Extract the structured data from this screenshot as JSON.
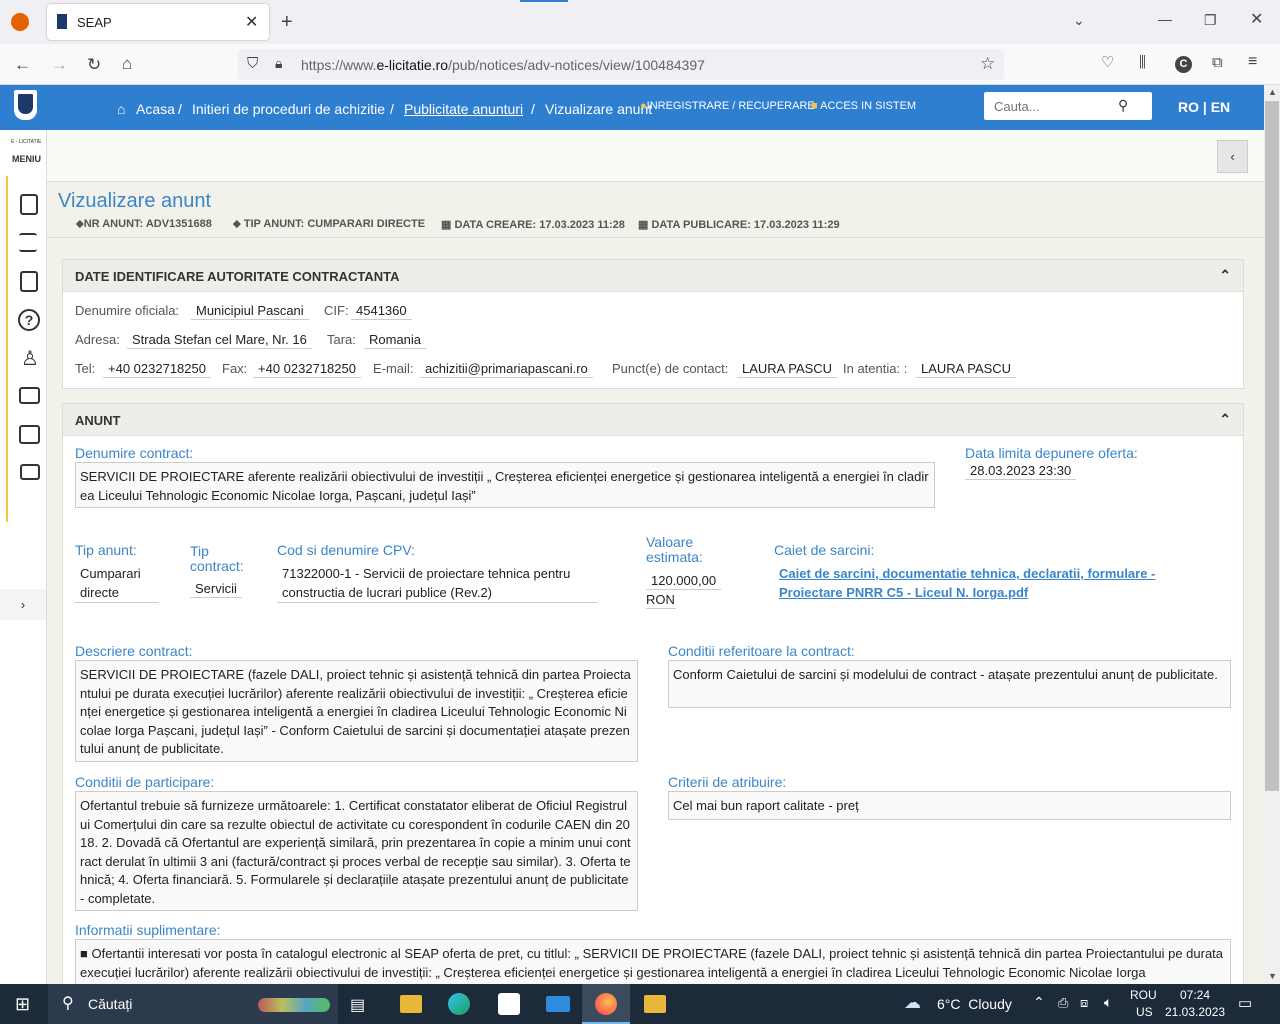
{
  "browser": {
    "tab_title": "SEAP",
    "url_prefix": "https://www.",
    "url_domain": "e-licitatie.ro",
    "url_path": "/pub/notices/adv-notices/view/100484397"
  },
  "site": {
    "breadcrumb": [
      "Acasa",
      "Initieri de proceduri de achizitie",
      "Publicitate anunturi",
      "Vizualizare anunt"
    ],
    "register_link": "INREGISTRARE / RECUPERARE",
    "login_link": "ACCES IN SISTEM",
    "search_placeholder": "Cauta...",
    "lang": "RO | EN",
    "menu_brand": "E - LICITATIE",
    "menu_label": "MENIU"
  },
  "page": {
    "title": "Vizualizare anunt",
    "nr_anunt": "NR ANUNT: ADV1351688",
    "tip_anunt": "TIP ANUNT: CUMPARARI DIRECTE",
    "data_creare": "DATA CREARE: 17.03.2023 11:28",
    "data_publicare": "DATA PUBLICARE: 17.03.2023 11:29"
  },
  "authority": {
    "header": "DATE IDENTIFICARE AUTORITATE CONTRACTANTA",
    "denumire_label": "Denumire oficiala:",
    "denumire": "Municipiul Pascani",
    "cif_label": "CIF:",
    "cif": "4541360",
    "adresa_label": "Adresa:",
    "adresa": "Strada Stefan cel Mare, Nr. 16",
    "tara_label": "Tara:",
    "tara": "Romania",
    "tel_label": "Tel:",
    "tel": "+40 0232718250",
    "fax_label": "Fax:",
    "fax": "+40 0232718250",
    "email_label": "E-mail:",
    "email": "achizitii@primariapascani.ro",
    "contact_label": "Punct(e) de contact:",
    "contact": "LAURA PASCU",
    "atentia_label": "In atentia: :",
    "atentia": "LAURA PASCU"
  },
  "anunt": {
    "header": "ANUNT",
    "denumire_label": "Denumire contract:",
    "denumire": "SERVICII DE PROIECTARE aferente realizării obiectivului de investiții „ Creșterea eficienței energetice și gestionarea inteligentă a energiei în cladirea Liceului Tehnologic Economic Nicolae Iorga, Pașcani, județul Iași”",
    "data_limita_label": "Data limita depunere oferta:",
    "data_limita": "28.03.2023 23:30",
    "tip_anunt_label": "Tip anunt:",
    "tip_anunt": "Cumparari directe",
    "tip_contract_label": "Tip contract:",
    "tip_contract": "Servicii",
    "cpv_label": "Cod si denumire CPV:",
    "cpv": "71322000-1 - Servicii de proiectare tehnica pentru constructia de lucrari publice (Rev.2)",
    "valoare_label": "Valoare estimata:",
    "valoare": "120.000,00",
    "moneda": "RON",
    "caiet_label": "Caiet de sarcini:",
    "caiet": "Caiet de sarcini, documentatie tehnica, declaratii, formulare - Proiectare PNRR C5 - Liceul N. Iorga.pdf",
    "descriere_label": "Descriere contract:",
    "descriere": "SERVICII DE PROIECTARE (fazele DALI, proiect tehnic și asistență tehnică din partea Proiectantului pe durata execuției lucrărilor) aferente realizării obiectivului de investiții: „ Creșterea eficienței energetice și gestionarea inteligentă a energiei în cladirea Liceului Tehnologic Economic Nicolae Iorga Pașcani, județul Iași” - Conform Caietului de sarcini și documentației atașate prezentului anunț de publicitate.",
    "conditii_ref_label": "Conditii referitoare la contract:",
    "conditii_ref": "Conform Caietului de sarcini și modelului de contract - atașate prezentului anunț de publicitate.",
    "conditii_part_label": "Conditii de participare:",
    "conditii_part": "Ofertantul trebuie să furnizeze următoarele: 1. Certificat constatator eliberat de Oficiul Registrului Comerțului din care sa rezulte obiectul de activitate cu corespondent în codurile CAEN din 2018. 2. Dovadă că Ofertantul are experiență similară, prin prezentarea în copie a minim unui contract derulat în ultimii 3 ani (factură/contract și proces verbal de recepție sau similar). 3. Oferta tehnică; 4. Oferta financiară. 5. Formularele și declarațiile atașate prezentului anunț de publicitate - completate.",
    "criterii_label": "Criterii de atribuire:",
    "criterii": "Cel mai bun raport calitate - preț",
    "info_label": "Informatii suplimentare:",
    "info": "■ Ofertantii interesati vor posta în catalogul electronic al SEAP oferta de pret, cu titlul: „ SERVICII DE PROIECTARE (fazele DALI, proiect tehnic și asistență tehnică din partea Proiectantului pe durata execuției lucrărilor) aferente realizării obiectivului de investiții: „ Creșterea eficienței energetice și gestionarea inteligentă a energiei în cladirea Liceului Tehnologic Economic Nicolae Iorga"
  },
  "taskbar": {
    "search": "Căutați",
    "weather": "6°C  Cloudy",
    "lang1": "ROU",
    "lang2": "US",
    "time": "07:24",
    "date": "21.03.2023"
  }
}
